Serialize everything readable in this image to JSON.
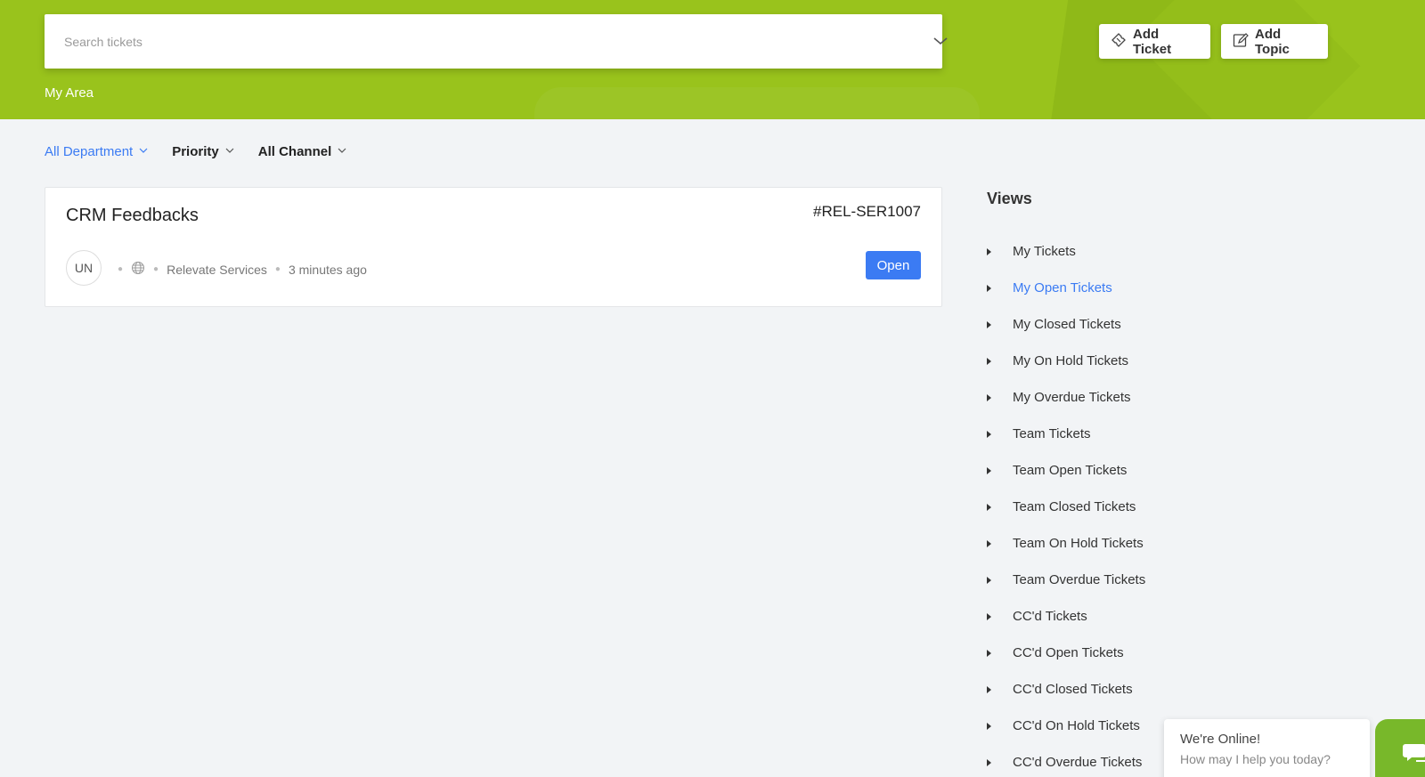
{
  "header": {
    "search": {
      "placeholder": "Search tickets",
      "value": ""
    },
    "breadcrumb": "My Area",
    "add_ticket_label": "Add Ticket",
    "add_topic_label": "Add Topic"
  },
  "filters": {
    "department": "All Department",
    "priority": "Priority",
    "channel": "All Channel"
  },
  "ticket": {
    "title": "CRM Feedbacks",
    "id": "#REL-SER1007",
    "avatar_initials": "UN",
    "channel_icon": "globe-icon",
    "department": "Relevate Services",
    "time": "3 minutes ago",
    "status": "Open"
  },
  "views": {
    "title": "Views",
    "items": [
      {
        "label": "My Tickets"
      },
      {
        "label": "My Open Tickets"
      },
      {
        "label": "My Closed Tickets"
      },
      {
        "label": "My On Hold Tickets"
      },
      {
        "label": "My Overdue Tickets"
      },
      {
        "label": "Team Tickets"
      },
      {
        "label": "Team Open Tickets"
      },
      {
        "label": "Team Closed Tickets"
      },
      {
        "label": "Team On Hold Tickets"
      },
      {
        "label": "Team Overdue Tickets"
      },
      {
        "label": "CC'd Tickets"
      },
      {
        "label": "CC'd Open Tickets"
      },
      {
        "label": "CC'd Closed Tickets"
      },
      {
        "label": "CC'd On Hold Tickets"
      },
      {
        "label": "CC'd Overdue Tickets"
      }
    ],
    "active_index": 1
  },
  "chat": {
    "title": "We're Online!",
    "subtitle": "How may I help you today?"
  },
  "colors": {
    "header_bg": "#99c31c",
    "accent": "#3b7bf3",
    "chat": "#78b82a"
  }
}
